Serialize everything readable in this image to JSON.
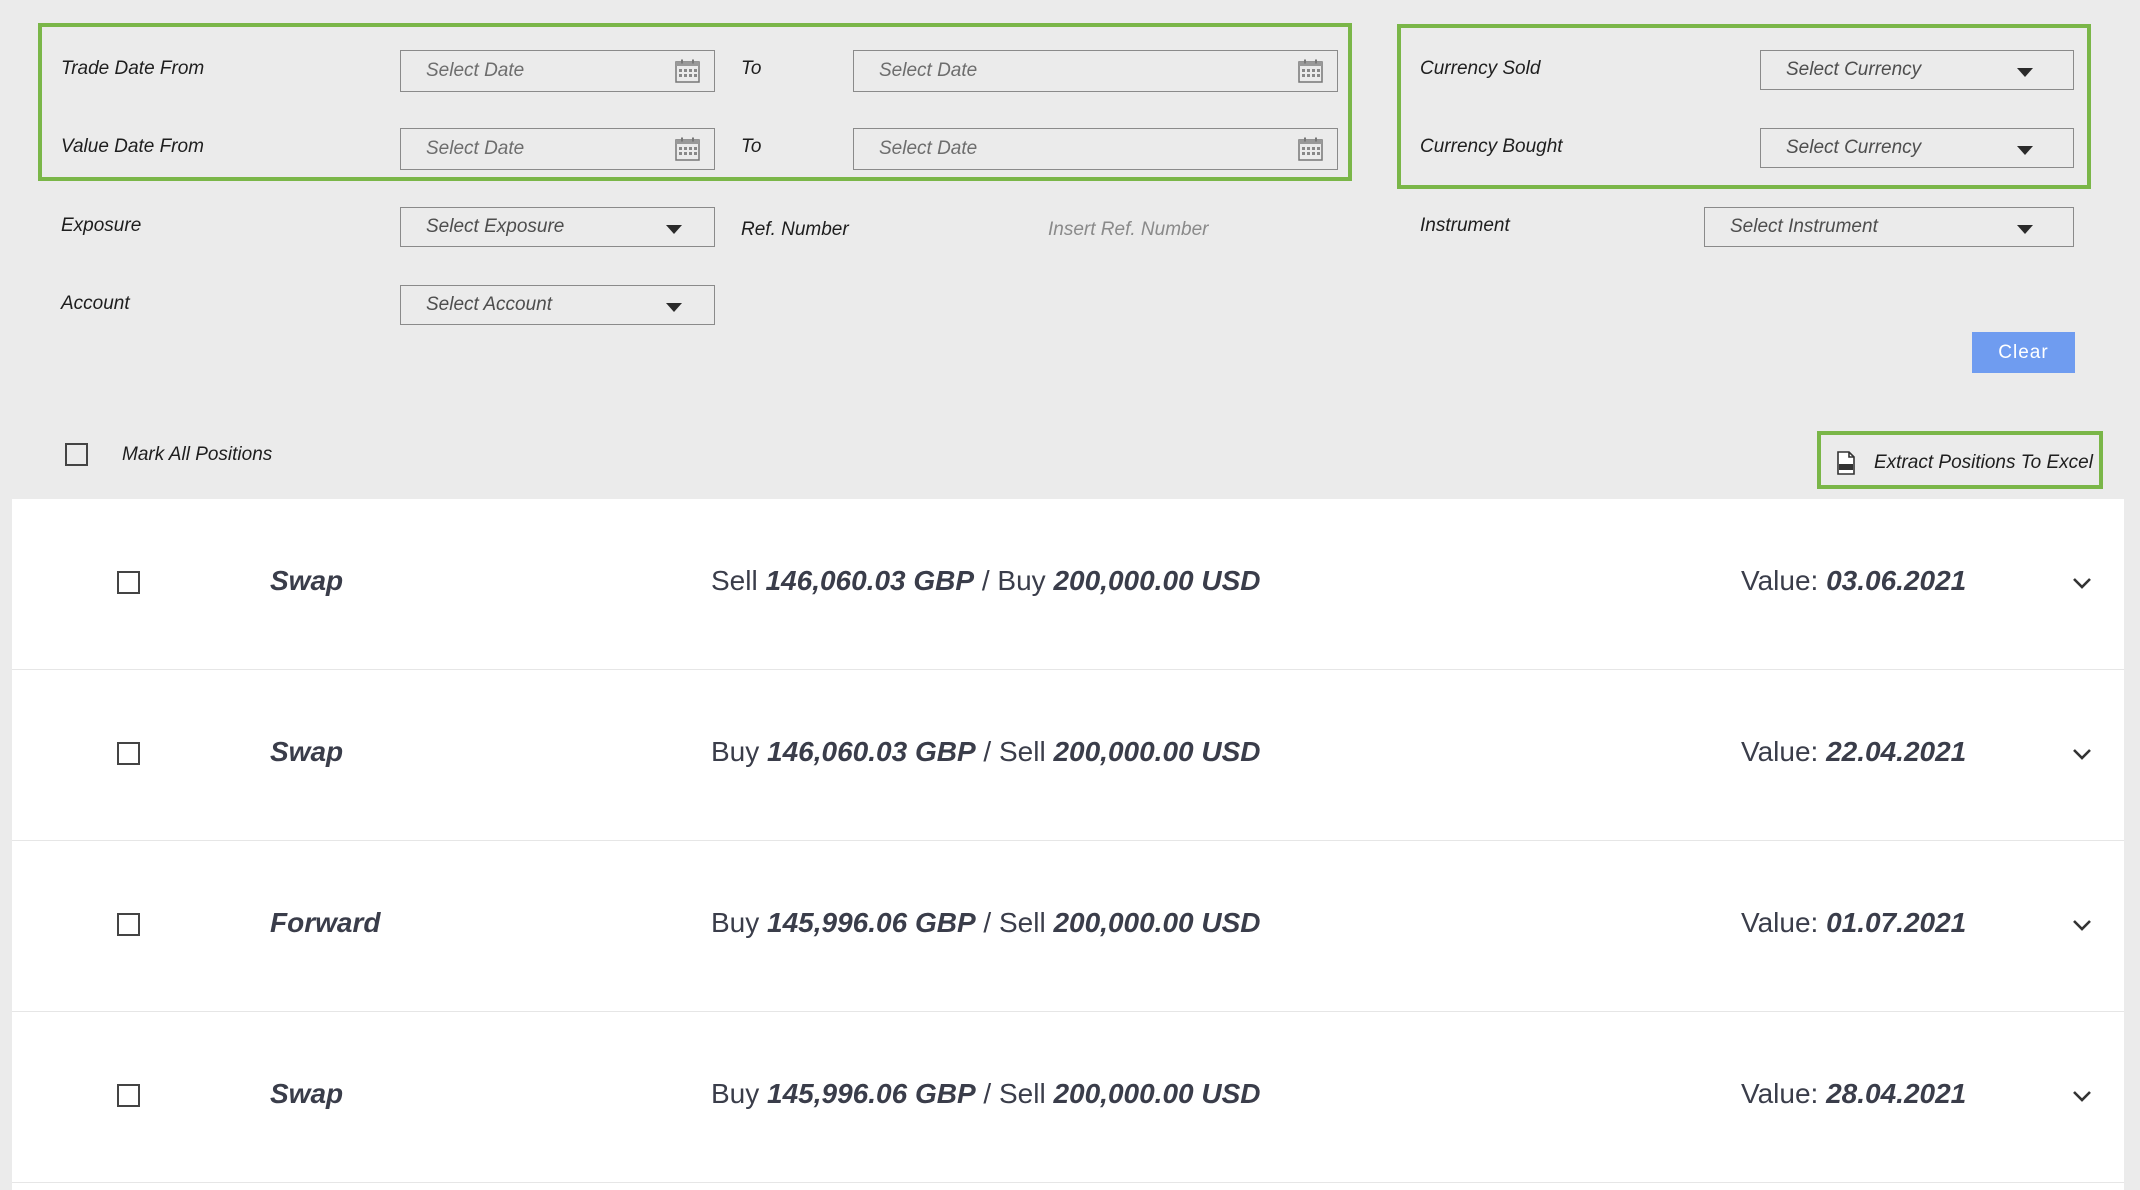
{
  "filters": {
    "trade_date_from_label": "Trade Date From",
    "value_date_from_label": "Value Date From",
    "to_label": "To",
    "date_placeholder": "Select Date",
    "currency_sold_label": "Currency Sold",
    "currency_bought_label": "Currency Bought",
    "currency_placeholder": "Select Currency",
    "exposure_label": "Exposure",
    "exposure_placeholder": "Select Exposure",
    "ref_number_label": "Ref. Number",
    "ref_number_placeholder": "Insert Ref. Number",
    "instrument_label": "Instrument",
    "instrument_placeholder": "Select Instrument",
    "account_label": "Account",
    "account_placeholder": "Select Account",
    "clear_label": "Clear"
  },
  "toolbar": {
    "mark_all_label": "Mark All Positions",
    "extract_label": "Extract Positions To Excel"
  },
  "positions": [
    {
      "type": "Swap",
      "side1": "Sell",
      "amount1": "146,060.03 GBP",
      "sep": "/",
      "side2": "Buy",
      "amount2": "200,000.00 USD",
      "value_label": "Value:",
      "value_date": "03.06.2021"
    },
    {
      "type": "Swap",
      "side1": "Buy",
      "amount1": "146,060.03 GBP",
      "sep": "/",
      "side2": "Sell",
      "amount2": "200,000.00 USD",
      "value_label": "Value:",
      "value_date": "22.04.2021"
    },
    {
      "type": "Forward",
      "side1": "Buy",
      "amount1": "145,996.06 GBP",
      "sep": "/",
      "side2": "Sell",
      "amount2": "200,000.00 USD",
      "value_label": "Value:",
      "value_date": "01.07.2021"
    },
    {
      "type": "Swap",
      "side1": "Buy",
      "amount1": "145,996.06 GBP",
      "sep": "/",
      "side2": "Sell",
      "amount2": "200,000.00 USD",
      "value_label": "Value:",
      "value_date": "28.04.2021"
    }
  ],
  "colors": {
    "highlight": "#7ab648",
    "clear_button": "#6f9cf0",
    "background": "#ebebeb"
  },
  "icons": {
    "date_picker": "calendar-icon",
    "dropdown": "caret-down-icon",
    "extract": "excel-file-icon",
    "expand": "chevron-down-icon"
  }
}
